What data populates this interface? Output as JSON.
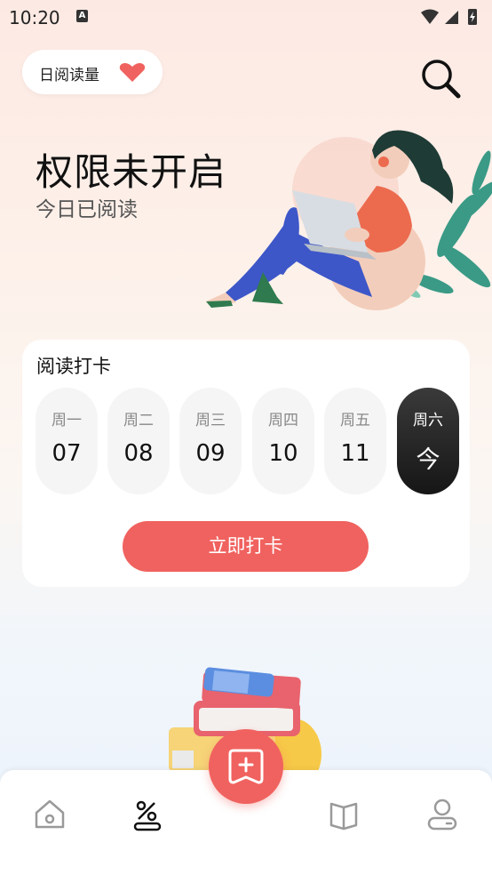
{
  "status_bar": {
    "time": "10:20",
    "notification_glyph": "A"
  },
  "header": {
    "stat_selector_label": "日阅读量",
    "heart_color": "#f0625f"
  },
  "hero": {
    "title": "权限未开启",
    "subtitle": "今日已阅读"
  },
  "checkin": {
    "title": "阅读打卡",
    "days": [
      {
        "name": "周一",
        "value": "07"
      },
      {
        "name": "周二",
        "value": "08"
      },
      {
        "name": "周三",
        "value": "09"
      },
      {
        "name": "周四",
        "value": "10"
      },
      {
        "name": "周五",
        "value": "11"
      },
      {
        "name": "周六",
        "value": "今"
      }
    ],
    "button_label": "立即打卡"
  },
  "bottom_nav": {
    "items": [
      "home-icon",
      "percent-icon",
      "book-icon",
      "user-icon"
    ],
    "fab_icon": "add-book-icon",
    "accent": "#f0625f"
  }
}
